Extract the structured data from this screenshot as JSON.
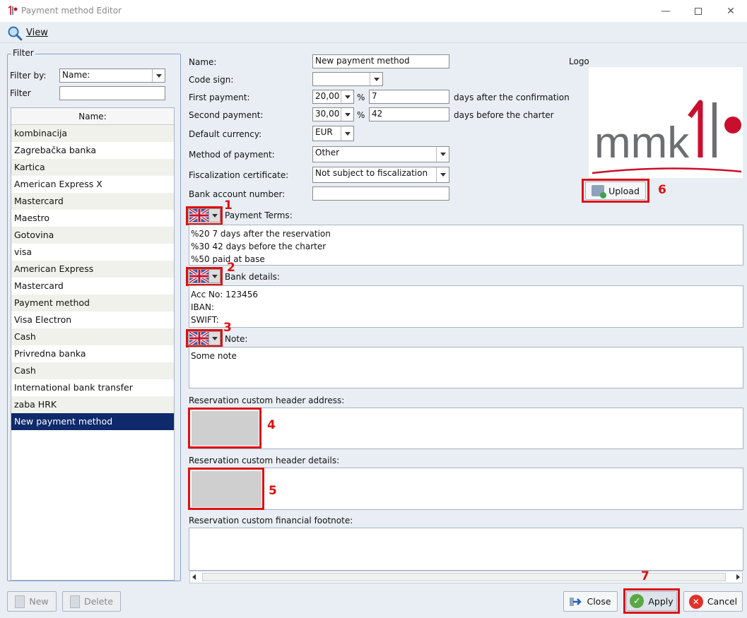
{
  "window": {
    "title": "Payment method Editor"
  },
  "menu": {
    "view_label": "View"
  },
  "filter": {
    "legend": "Filter",
    "filter_by_label": "Filter by:",
    "filter_by_value": "Name:",
    "filter_label": "Filter",
    "filter_value": ""
  },
  "list": {
    "header": "Name:",
    "items": [
      "kombinacija",
      "Zagrebačka banka",
      "Kartica",
      "American Express X",
      "Mastercard",
      "Maestro",
      "Gotovina",
      "visa",
      "American Express",
      "Mastercard",
      "Payment method",
      "Visa Electron",
      "Cash",
      "Privredna banka",
      "Cash",
      "International bank transfer",
      "zaba HRK",
      "New payment method"
    ],
    "selected_index": 17
  },
  "form": {
    "name_label": "Name:",
    "name_value": "New payment method",
    "code_sign_label": "Code sign:",
    "code_sign_value": "",
    "first_payment_label": "First payment:",
    "first_payment_pct": "20,00",
    "first_payment_days": "7",
    "first_payment_suffix": "days after the confirmation",
    "second_payment_label": "Second payment:",
    "second_payment_pct": "30,00",
    "second_payment_days": "42",
    "second_payment_suffix": "days before the charter",
    "percent_sign": "%",
    "currency_label": "Default currency:",
    "currency_value": "EUR",
    "method_label": "Method of payment:",
    "method_value": "Other",
    "fiscal_label": "Fiscalization certificate:",
    "fiscal_value": "Not subject to fiscalization",
    "bank_account_label": "Bank account number:",
    "bank_account_value": "",
    "logo_label": "Logo",
    "logo_text": "mmk",
    "upload_label": "Upload",
    "payment_terms_label": "Payment Terms:",
    "payment_terms_lines": [
      "%20 7 days after the reservation",
      "%30 42 days before the charter",
      "%50 paid at base"
    ],
    "bank_details_label": "Bank details:",
    "bank_details_lines": [
      "Acc No: 123456",
      "IBAN:",
      "SWIFT:"
    ],
    "note_label": "Note:",
    "note_value": "Some note",
    "header_address_label": "Reservation custom header address:",
    "header_details_label": "Reservation custom header details:",
    "footnote_label": "Reservation custom financial footnote:"
  },
  "annotations": [
    "1",
    "2",
    "3",
    "4",
    "5",
    "6",
    "7"
  ],
  "buttons": {
    "new_label": "New",
    "delete_label": "Delete",
    "close_label": "Close",
    "apply_label": "Apply",
    "cancel_label": "Cancel"
  },
  "colors": {
    "accent_red": "#d11111",
    "selection": "#0e2a6b",
    "logo_red": "#c8102e",
    "logo_gray": "#6d6e71"
  }
}
